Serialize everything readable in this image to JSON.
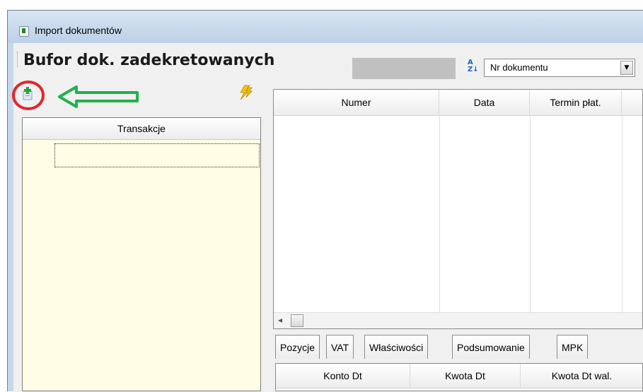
{
  "window": {
    "title": "Import dokumentów"
  },
  "toolbar": {
    "buffer_title": "Bufor dok. zadekretowanych",
    "sort_select_value": "Nr dokumentu"
  },
  "left_panel": {
    "header": "Transakcje"
  },
  "document_grid": {
    "columns": [
      "Numer",
      "Data",
      "Termin płat."
    ]
  },
  "tabs": [
    {
      "label": "Pozycje"
    },
    {
      "label": "VAT"
    },
    {
      "label": "Właściwości"
    },
    {
      "label": "Podsumowanie"
    },
    {
      "label": "MPK"
    }
  ],
  "positions_grid": {
    "columns": [
      "Konto Dt",
      "Kwota Dt",
      "Kwota Dt wal."
    ]
  },
  "colors": {
    "highlight_circle": "#e3262d",
    "arrow": "#22b14c",
    "left_panel_bg": "#fffde5"
  }
}
